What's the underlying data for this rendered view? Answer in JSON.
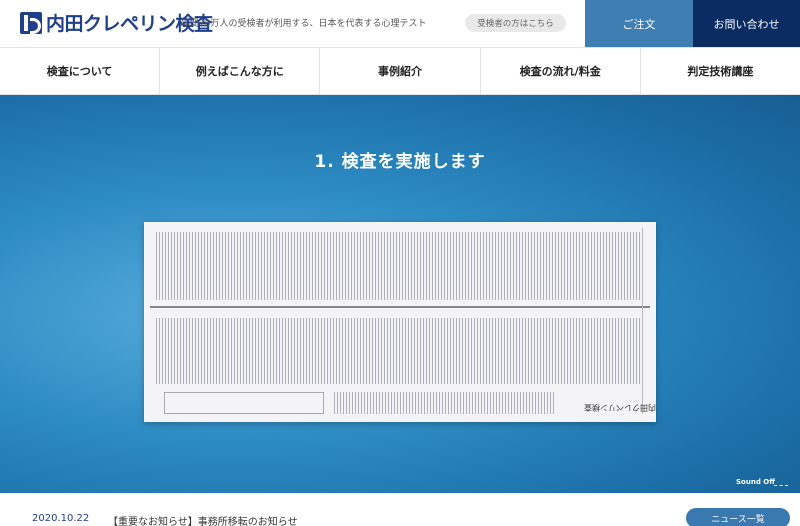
{
  "header": {
    "logo_text": "内田クレペリン検査",
    "tagline": "年間70万人の受検者が利用する、日本を代表する心理テスト",
    "examinee_link": "受検者の方はこちら",
    "order_button": "ご注文",
    "contact_button": "お問い合わせ"
  },
  "nav": {
    "items": [
      {
        "label": "検査について"
      },
      {
        "label": "例えばこんな方に"
      },
      {
        "label": "事例紹介"
      },
      {
        "label": "検査の流れ/料金"
      },
      {
        "label": "判定技術講座"
      }
    ]
  },
  "hero": {
    "title": "1. 検査を実施します",
    "sheet_logo_text": "内田クレペリン検査",
    "sound_label": "Sound Off"
  },
  "news": {
    "date": "2020.10.22",
    "title": "【重要なお知らせ】事務所移転のお知らせ",
    "list_button": "ニュース一覧"
  },
  "colors": {
    "brand": "#1f3f8a",
    "order_bg": "#3f7eb3",
    "contact_bg": "#0b2b63",
    "hero_bg": "#2e8cc4"
  }
}
